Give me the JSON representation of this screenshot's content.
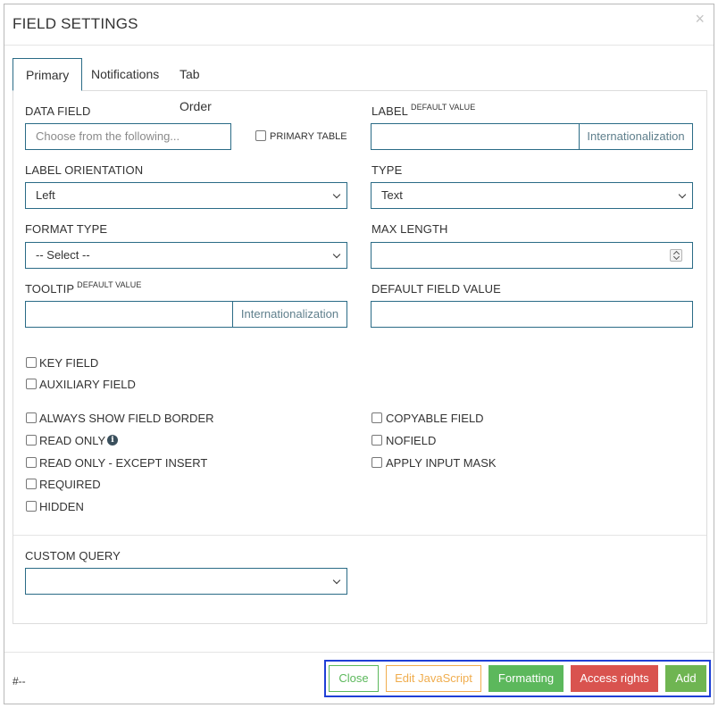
{
  "modal": {
    "title": "FIELD SETTINGS",
    "close_glyph": "×"
  },
  "tabs": [
    {
      "label": "Primary"
    },
    {
      "label": "Notifications"
    },
    {
      "label": "Tab Order"
    }
  ],
  "primary": {
    "data_field": {
      "label": "DATA FIELD",
      "placeholder": "Choose from the following...",
      "value": ""
    },
    "primary_table": {
      "label": "PRIMARY TABLE"
    },
    "label_field": {
      "label": "LABEL",
      "sup": "DEFAULT VALUE",
      "value": "",
      "addon": "Internationalization"
    },
    "label_orientation": {
      "label": "LABEL ORIENTATION",
      "value": "Left"
    },
    "type": {
      "label": "TYPE",
      "value": "Text"
    },
    "format_type": {
      "label": "FORMAT TYPE",
      "value": "-- Select --"
    },
    "max_length": {
      "label": "MAX LENGTH",
      "value": ""
    },
    "tooltip": {
      "label": "TOOLTIP",
      "sup": "DEFAULT VALUE",
      "value": "",
      "addon": "Internationalization"
    },
    "default_field_value": {
      "label": "DEFAULT FIELD VALUE",
      "value": ""
    },
    "checkboxes_top": [
      {
        "label": "KEY FIELD",
        "checked": false
      },
      {
        "label": "AUXILIARY FIELD",
        "checked": false
      }
    ],
    "checkboxes_left": [
      {
        "label": "ALWAYS SHOW FIELD BORDER",
        "checked": false
      },
      {
        "label": "READ ONLY",
        "checked": false,
        "icon": "info-icon"
      },
      {
        "label": "READ ONLY - EXCEPT INSERT",
        "checked": false
      },
      {
        "label": "REQUIRED",
        "checked": false
      },
      {
        "label": "HIDDEN",
        "checked": false
      }
    ],
    "checkboxes_right": [
      {
        "label": "COPYABLE FIELD",
        "checked": false
      },
      {
        "label": "NOFIELD",
        "checked": false
      },
      {
        "label": "APPLY INPUT MASK",
        "checked": false
      }
    ],
    "custom_query": {
      "label": "CUSTOM QUERY",
      "value": ""
    }
  },
  "footer": {
    "id_text": "#--",
    "buttons": {
      "close": "Close",
      "edit_js": "Edit JavaScript",
      "formatting": "Formatting",
      "access_rights": "Access rights",
      "add": "Add"
    }
  },
  "colors": {
    "input_border": "#2a6b86",
    "success": "#5cb85c",
    "warning": "#f0ad4e",
    "danger": "#d9534f",
    "highlight": "#1f3fd6"
  }
}
